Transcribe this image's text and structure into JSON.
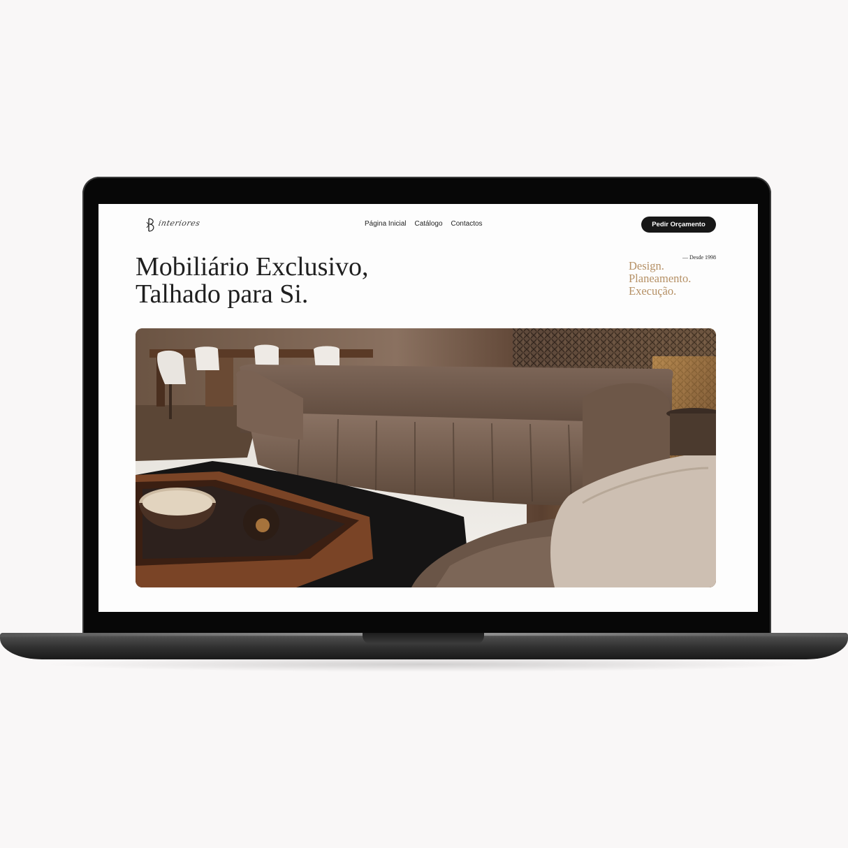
{
  "site": {
    "logo_text": "interiores",
    "nav": [
      {
        "label": "Página Inicial"
      },
      {
        "label": "Catálogo"
      },
      {
        "label": "Contactos"
      }
    ],
    "cta_label": "Pedir Orçamento"
  },
  "hero": {
    "title_line1": "Mobiliário Exclusivo,",
    "title_line2": "Talhado para Si.",
    "since": "— Desde 1998",
    "tagline": [
      "Design.",
      "Planeamento.",
      "Execução."
    ]
  },
  "colors": {
    "accent": "#b59065",
    "button_bg": "#171717",
    "page_bg": "#f9f7f7"
  }
}
